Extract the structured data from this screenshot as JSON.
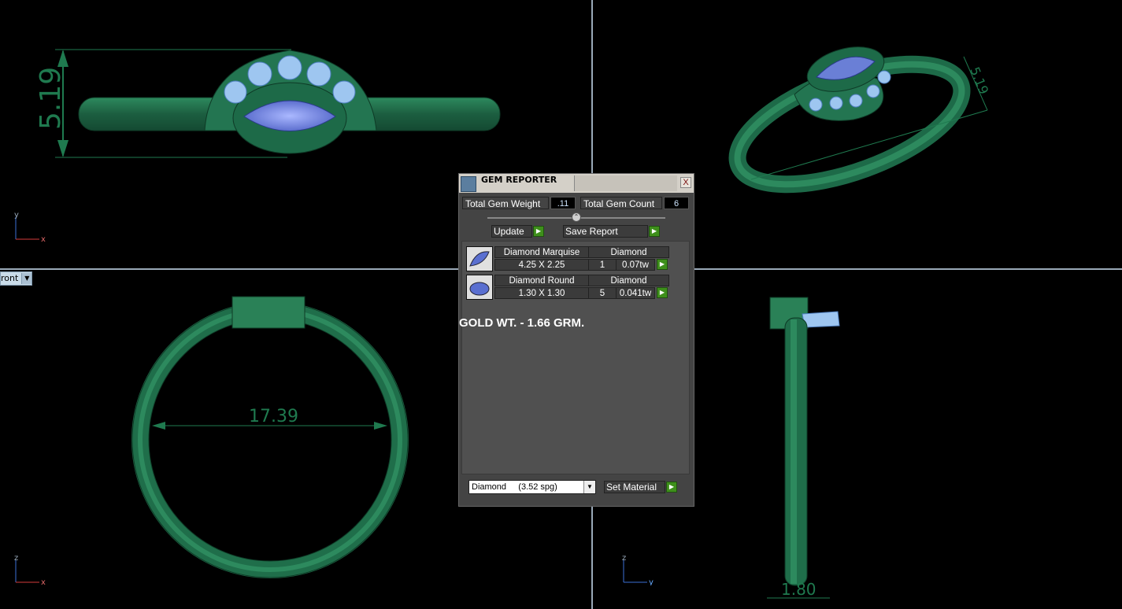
{
  "viewports": {
    "top_left": {
      "dimension": "5.19",
      "axis_v": "y",
      "axis_h": "x"
    },
    "top_right": {
      "dimension": "5.19"
    },
    "bottom_left": {
      "dimension": "17.39",
      "axis_v": "z",
      "axis_h": "x",
      "view_label": "ront"
    },
    "bottom_right": {
      "dimension": "1.80",
      "axis_v": "z",
      "axis_h": "y"
    }
  },
  "gem_reporter": {
    "title": "GEM REPORTER",
    "close": "X",
    "total_weight_label": "Total Gem Weight",
    "total_weight_value": ".11",
    "total_count_label": "Total Gem Count",
    "total_count_value": "6",
    "update_label": "Update",
    "save_report_label": "Save Report",
    "gems": [
      {
        "name": "Diamond Marquise",
        "size": "4.25 X 2.25",
        "material": "Diamond",
        "count": "1",
        "weight": "0.07tw"
      },
      {
        "name": "Diamond Round",
        "size": "1.30 X 1.30",
        "material": "Diamond",
        "count": "5",
        "weight": "0.041tw"
      }
    ],
    "gold_weight": "GOLD WT. - 1.66 GRM.",
    "material_select": "Diamond     (3.52 spg)",
    "set_material_label": "Set Material"
  },
  "colors": {
    "metal": "#1f6e4a",
    "gem": "#6a7fd6",
    "accent": "#3e8f1b"
  }
}
